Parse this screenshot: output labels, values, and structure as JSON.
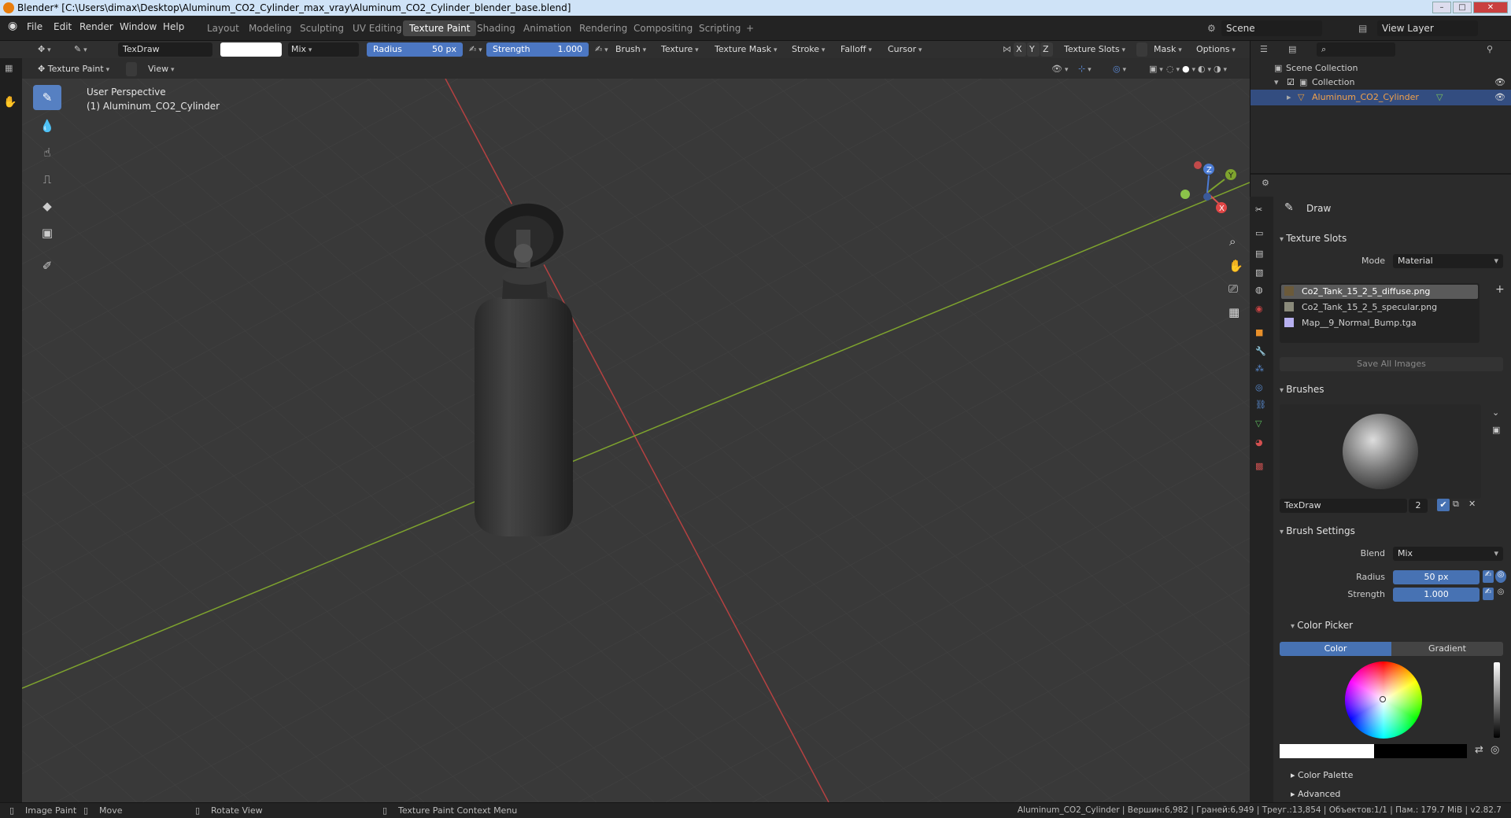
{
  "window": {
    "title": "Blender* [C:\\Users\\dimax\\Desktop\\Aluminum_CO2_Cylinder_max_vray\\Aluminum_CO2_Cylinder_blender_base.blend]"
  },
  "menu": {
    "file": "File",
    "edit": "Edit",
    "render": "Render",
    "window": "Window",
    "help": "Help"
  },
  "workspaces": [
    "Layout",
    "Modeling",
    "Sculpting",
    "UV Editing",
    "Texture Paint",
    "Shading",
    "Animation",
    "Rendering",
    "Compositing",
    "Scripting",
    "+"
  ],
  "scene": {
    "name": "Scene",
    "view_layer": "View Layer"
  },
  "toolheader": {
    "brush_name": "TexDraw",
    "blend": "Mix",
    "radius_label": "Radius",
    "radius_value": "50 px",
    "strength_label": "Strength",
    "strength_value": "1.000",
    "brush": "Brush",
    "texture": "Texture",
    "texture_mask": "Texture Mask",
    "stroke": "Stroke",
    "falloff": "Falloff",
    "cursor": "Cursor",
    "x": "X",
    "y": "Y",
    "z": "Z",
    "texture_slots": "Texture Slots",
    "mask": "Mask",
    "options": "Options"
  },
  "viewport": {
    "mode": "Texture Paint",
    "view_menu": "View",
    "perspective": "User Perspective",
    "object_label": "(1) Aluminum_CO2_Cylinder",
    "gizmo": {
      "x": "X",
      "y": "Y",
      "z": "Z"
    }
  },
  "outliner": {
    "scene_collection": "Scene Collection",
    "collection": "Collection",
    "object": "Aluminum_CO2_Cylinder"
  },
  "properties": {
    "tool_name": "Draw",
    "texture_slots_header": "Texture Slots",
    "mode_label": "Mode",
    "mode_value": "Material",
    "slots": [
      "Co2_Tank_15_2_5_diffuse.png",
      "Co2_Tank_15_2_5_specular.png",
      "Map__9_Normal_Bump.tga"
    ],
    "save_all": "Save All Images",
    "brushes_header": "Brushes",
    "brush_name": "TexDraw",
    "brush_users": "2",
    "brush_settings_header": "Brush Settings",
    "blend_label": "Blend",
    "blend_value": "Mix",
    "radius_label": "Radius",
    "radius_value": "50 px",
    "strength_label": "Strength",
    "strength_value": "1.000",
    "color_picker_header": "Color Picker",
    "color_tab": "Color",
    "gradient_tab": "Gradient",
    "color_palette": "Color Palette",
    "advanced": "Advanced"
  },
  "statusbar": {
    "image_paint": "Image Paint",
    "move": "Move",
    "rotate_view": "Rotate View",
    "context_menu": "Texture Paint Context Menu",
    "stats": "Aluminum_CO2_Cylinder | Вершин:6,982 | Граней:6,949 | Треуг.:13,854 | Объектов:1/1 | Пам.: 179.7 MiB | v2.82.7"
  },
  "colors": {
    "accent": "#4772b3",
    "x_axis": "#b54141",
    "y_axis": "#7ea32e",
    "active_tab": "#474747"
  }
}
